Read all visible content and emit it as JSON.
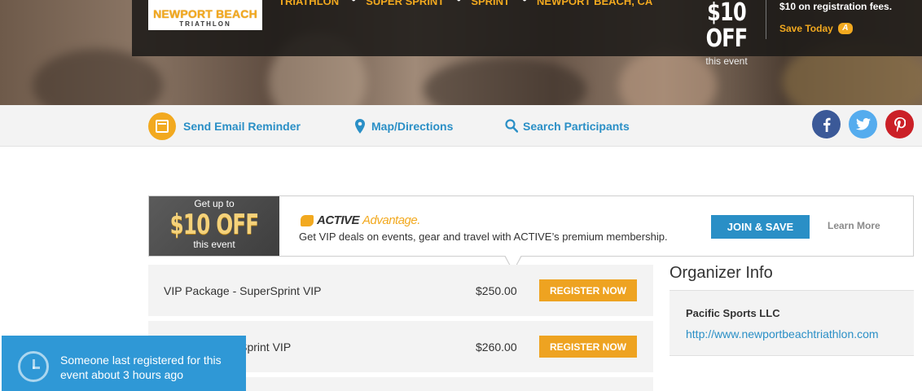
{
  "hero": {
    "logo_line1": "NEWPORT BEACH",
    "logo_line2": "TRIATHLON",
    "tags": [
      "TRIATHLON",
      "SUPER SPRINT",
      "SPRINT",
      "NEWPORT BEACH, CA"
    ],
    "promo_big": "$10 OFF",
    "promo_small": "this event",
    "promo_text": "$10 on registration fees.",
    "save_today": "Save Today"
  },
  "action_bar": {
    "email_reminder": "Send Email Reminder",
    "map_directions": "Map/Directions",
    "search_participants": "Search Participants",
    "social": [
      {
        "name": "facebook",
        "glyph": "f",
        "color": "#3b5998"
      },
      {
        "name": "twitter",
        "glyph": "t",
        "color": "#55acee"
      },
      {
        "name": "pinterest",
        "glyph": "p",
        "color": "#cb2027"
      }
    ]
  },
  "advantage": {
    "get_up_to": "Get up to",
    "off": "$10 OFF",
    "this_event": "this event",
    "brand_active": "ACTIVE",
    "brand_advantage": "Advantage.",
    "description": "Get VIP deals on events, gear and travel with ACTIVE’s premium membership.",
    "join_label": "JOIN & SAVE",
    "learn_more": "Learn More"
  },
  "packages": [
    {
      "name": "VIP Package - SuperSprint VIP",
      "price": "$250.00",
      "button": "REGISTER NOW"
    },
    {
      "name": "VIP Package - Sprint VIP",
      "price": "$260.00",
      "button": "REGISTER NOW"
    }
  ],
  "organizer": {
    "title": "Organizer Info",
    "name": "Pacific Sports LLC",
    "url": "http://www.newportbeachtriathlon.com"
  },
  "toast": {
    "message": "Someone last registered for this event about 3 hours ago"
  },
  "colors": {
    "accent_orange": "#f2a91f",
    "link_blue": "#2a8fc6",
    "toast_blue": "#2f98d6"
  }
}
